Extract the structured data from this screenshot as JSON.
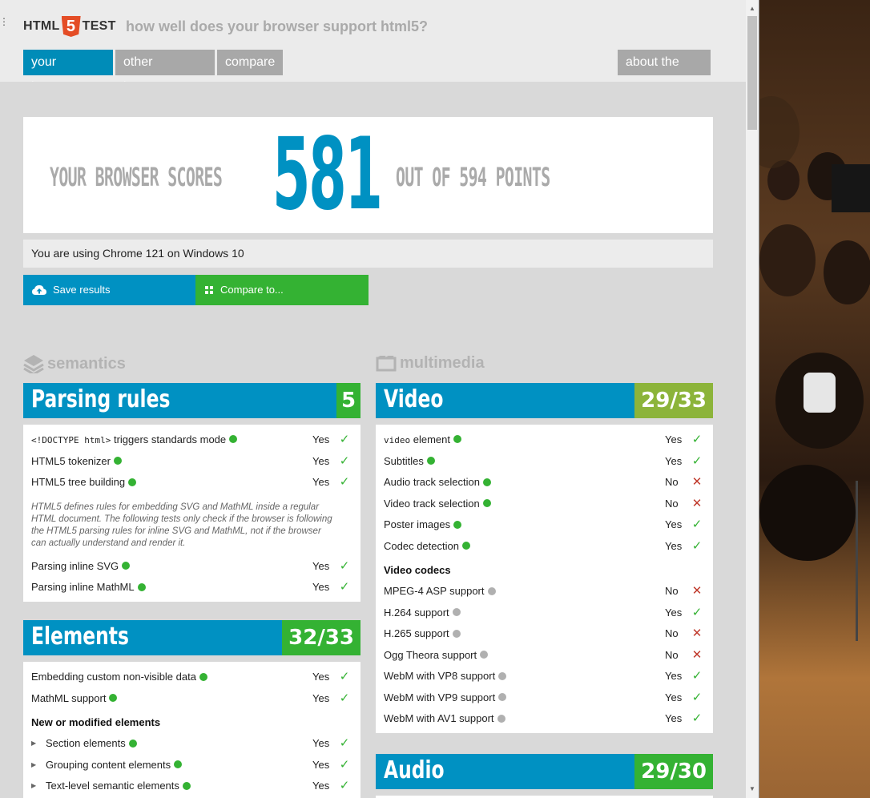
{
  "header": {
    "logo_left": "HTML",
    "logo_number": "5",
    "logo_right": "TEST",
    "tagline": "how well does your browser support html5?",
    "nav": [
      "your browser",
      "other browsers",
      "compare"
    ],
    "about": "about the test"
  },
  "score": {
    "pre": "YOUR BROWSER SCORES",
    "value": "581",
    "post": "OUT OF 594 POINTS"
  },
  "using": "You are using Chrome 121 on Windows 10",
  "buttons": {
    "save": "Save results",
    "compare": "Compare to..."
  },
  "categories": {
    "left": "semantics",
    "right": "multimedia"
  },
  "parsing": {
    "title": "Parsing rules",
    "score": "5",
    "rows": [
      {
        "code": "<!DOCTYPE html>",
        "label": " triggers standards mode",
        "value": "Yes"
      },
      {
        "label": "HTML5 tokenizer",
        "value": "Yes"
      },
      {
        "label": "HTML5 tree building",
        "value": "Yes"
      }
    ],
    "note": "HTML5 defines rules for embedding SVG and MathML inside a regular HTML document. The following tests only check if the browser is following the HTML5 parsing rules for inline SVG and MathML, not if the browser can actually understand and render it.",
    "rows2": [
      {
        "label": "Parsing inline SVG",
        "value": "Yes"
      },
      {
        "label": "Parsing inline MathML",
        "value": "Yes"
      }
    ]
  },
  "elements": {
    "title": "Elements",
    "score": "32/33",
    "rows": [
      {
        "label": "Embedding custom non-visible data",
        "value": "Yes"
      },
      {
        "label": "MathML support",
        "value": "Yes"
      }
    ],
    "subhead": "New or modified elements",
    "rows2": [
      {
        "label": "Section elements",
        "value": "Yes"
      },
      {
        "label": "Grouping content elements",
        "value": "Yes"
      },
      {
        "label": "Text-level semantic elements",
        "value": "Yes"
      }
    ]
  },
  "video": {
    "title": "Video",
    "score": "29/33",
    "rows": [
      {
        "code": "video",
        "label": " element",
        "value": "Yes"
      },
      {
        "label": "Subtitles",
        "value": "Yes"
      },
      {
        "label": "Audio track selection",
        "value": "No"
      },
      {
        "label": "Video track selection",
        "value": "No"
      },
      {
        "label": "Poster images",
        "value": "Yes"
      },
      {
        "label": "Codec detection",
        "value": "Yes"
      }
    ],
    "subhead": "Video codecs",
    "rows2": [
      {
        "label": "MPEG-4 ASP support",
        "value": "No"
      },
      {
        "label": "H.264 support",
        "value": "Yes"
      },
      {
        "label": "H.265 support",
        "value": "No"
      },
      {
        "label": "Ogg Theora support",
        "value": "No"
      },
      {
        "label": "WebM with VP8 support",
        "value": "Yes"
      },
      {
        "label": "WebM with VP9 support",
        "value": "Yes"
      },
      {
        "label": "WebM with AV1 support",
        "value": "Yes"
      }
    ]
  },
  "audio": {
    "title": "Audio",
    "score": "29/30"
  },
  "icons": {
    "menu": "menu-dots-icon",
    "save": "cloud-upload-icon",
    "compare": "grid-icon",
    "semantics": "stack-icon",
    "multimedia": "film-icon",
    "pass": "smiley-icon",
    "yes": "check-icon",
    "no": "cross-icon"
  },
  "colors": {
    "blue": "#0091c2",
    "green": "#34b233",
    "olive": "#8cb43a",
    "red": "#c0392b"
  }
}
